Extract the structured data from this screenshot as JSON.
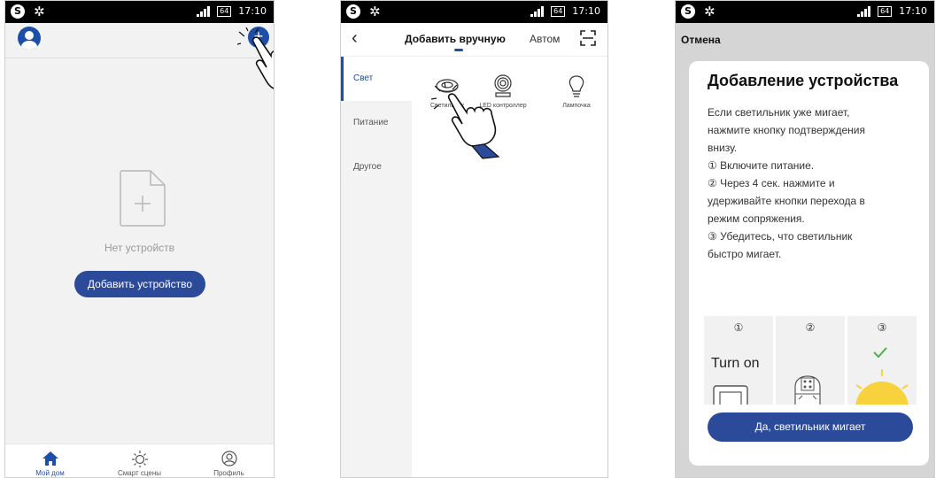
{
  "status_bar": {
    "time": "17:10",
    "battery": "64",
    "skype_icon": "S"
  },
  "screen1": {
    "empty_text": "Нет устройств",
    "add_device_button": "Добавить устройство",
    "add_icon": "+",
    "tabs": [
      {
        "label": "Мой дом",
        "icon": "home-icon"
      },
      {
        "label": "Смарт сцены",
        "icon": "sun-icon"
      },
      {
        "label": "Профиль",
        "icon": "profile-icon"
      }
    ]
  },
  "screen2": {
    "back": "‹",
    "title": "Добавить вручную",
    "auto_tab": "Автом",
    "categories": [
      "Свет",
      "Питание",
      "Другое"
    ],
    "devices": [
      "Светильник",
      "LED контроллер",
      "Лампочка"
    ]
  },
  "screen3": {
    "cancel": "Отмена",
    "title": "Добавление устройства",
    "lines": [
      "Если светильник уже мигает,",
      "нажмите кнопку подтверждения",
      "внизу.",
      "① Включите питание.",
      "② Через 4 сек. нажмите и",
      "удерживайте кнопки перехода в",
      "режим сопряжения.",
      "③ Убедитесь, что светильник",
      "быстро мигает."
    ],
    "steps": [
      "①",
      "②",
      "③"
    ],
    "step1_text": "Turn on",
    "confirm_button": "Да, светильник мигает"
  },
  "colors": {
    "primary": "#2c4a9a",
    "accent_blue": "#1e4fa8",
    "check_green": "#4caf50",
    "sun_yellow": "#f7d23c"
  }
}
